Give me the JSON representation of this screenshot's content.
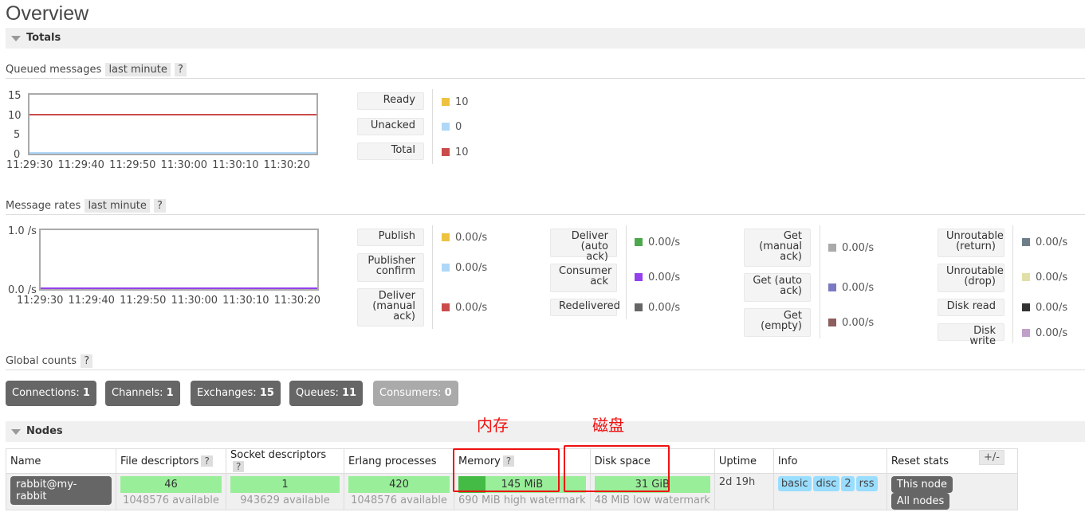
{
  "page": {
    "title": "Overview"
  },
  "totals": {
    "label": "Totals"
  },
  "queued": {
    "heading": "Queued messages",
    "range": "last minute",
    "help": "?",
    "y_ticks": [
      "15",
      "10",
      "5",
      "0"
    ],
    "x_ticks": [
      "11:29:30",
      "11:29:40",
      "11:29:50",
      "11:30:00",
      "11:30:10",
      "11:30:20"
    ],
    "legend": [
      {
        "label": "Ready",
        "value": "10",
        "color": "#edc240"
      },
      {
        "label": "Unacked",
        "value": "0",
        "color": "#afd8f8"
      },
      {
        "label": "Total",
        "value": "10",
        "color": "#cb4b4b"
      }
    ]
  },
  "rates": {
    "heading": "Message rates",
    "range": "last minute",
    "help": "?",
    "y_ticks": [
      "1.0 /s",
      "0.0 /s"
    ],
    "x_ticks": [
      "11:29:30",
      "11:29:40",
      "11:29:50",
      "11:30:00",
      "11:30:10",
      "11:30:20"
    ],
    "col1": [
      {
        "label": "Publish",
        "value": "0.00/s",
        "color": "#edc240"
      },
      {
        "label": "Publisher confirm",
        "value": "0.00/s",
        "color": "#afd8f8"
      },
      {
        "label": "Deliver (manual ack)",
        "value": "0.00/s",
        "color": "#cb4b4b"
      }
    ],
    "col2": [
      {
        "label": "Deliver (auto ack)",
        "value": "0.00/s",
        "color": "#4da74d"
      },
      {
        "label": "Consumer ack",
        "value": "0.00/s",
        "color": "#9440ed"
      },
      {
        "label": "Redelivered",
        "value": "0.00/s",
        "color": "#666666"
      }
    ],
    "col3": [
      {
        "label": "Get (manual ack)",
        "value": "0.00/s",
        "color": "#aaaaaa"
      },
      {
        "label": "Get (auto ack)",
        "value": "0.00/s",
        "color": "#7c79c3"
      },
      {
        "label": "Get (empty)",
        "value": "0.00/s",
        "color": "#8c5e5e"
      }
    ],
    "col4": [
      {
        "label": "Unroutable (return)",
        "value": "0.00/s",
        "color": "#6d7e88"
      },
      {
        "label": "Unroutable (drop)",
        "value": "0.00/s",
        "color": "#e0e0a8"
      },
      {
        "label": "Disk read",
        "value": "0.00/s",
        "color": "#333333"
      },
      {
        "label": "Disk write",
        "value": "0.00/s",
        "color": "#c0a0c8"
      }
    ]
  },
  "global": {
    "heading": "Global counts",
    "help": "?",
    "counts": [
      {
        "label": "Connections:",
        "value": "1"
      },
      {
        "label": "Channels:",
        "value": "1"
      },
      {
        "label": "Exchanges:",
        "value": "15"
      },
      {
        "label": "Queues:",
        "value": "11"
      },
      {
        "label": "Consumers:",
        "value": "0"
      }
    ]
  },
  "nodes": {
    "label": "Nodes",
    "headers": {
      "name": "Name",
      "fd": "File descriptors",
      "sock": "Socket descriptors",
      "erl": "Erlang processes",
      "mem": "Memory",
      "disk": "Disk space",
      "uptime": "Uptime",
      "info": "Info",
      "reset": "Reset stats"
    },
    "help": "?",
    "plusminus": "+/-",
    "row": {
      "name": "rabbit@my-rabbit",
      "fd": "46",
      "fd_avail": "1048576 available",
      "sock": "1",
      "sock_avail": "943629 available",
      "erl": "420",
      "erl_avail": "1048576 available",
      "mem": "145 MiB",
      "mem_fraction": 0.21,
      "mem_sub": "690 MiB high watermark",
      "disk": "31 GiB",
      "disk_sub": "48 MiB low watermark",
      "uptime": "2d 19h",
      "info_tags": [
        "basic",
        "disc",
        "2",
        "rss"
      ],
      "reset_this": "This node",
      "reset_all": "All nodes"
    }
  },
  "annotations": {
    "memory": "内存",
    "disk": "磁盘"
  }
}
